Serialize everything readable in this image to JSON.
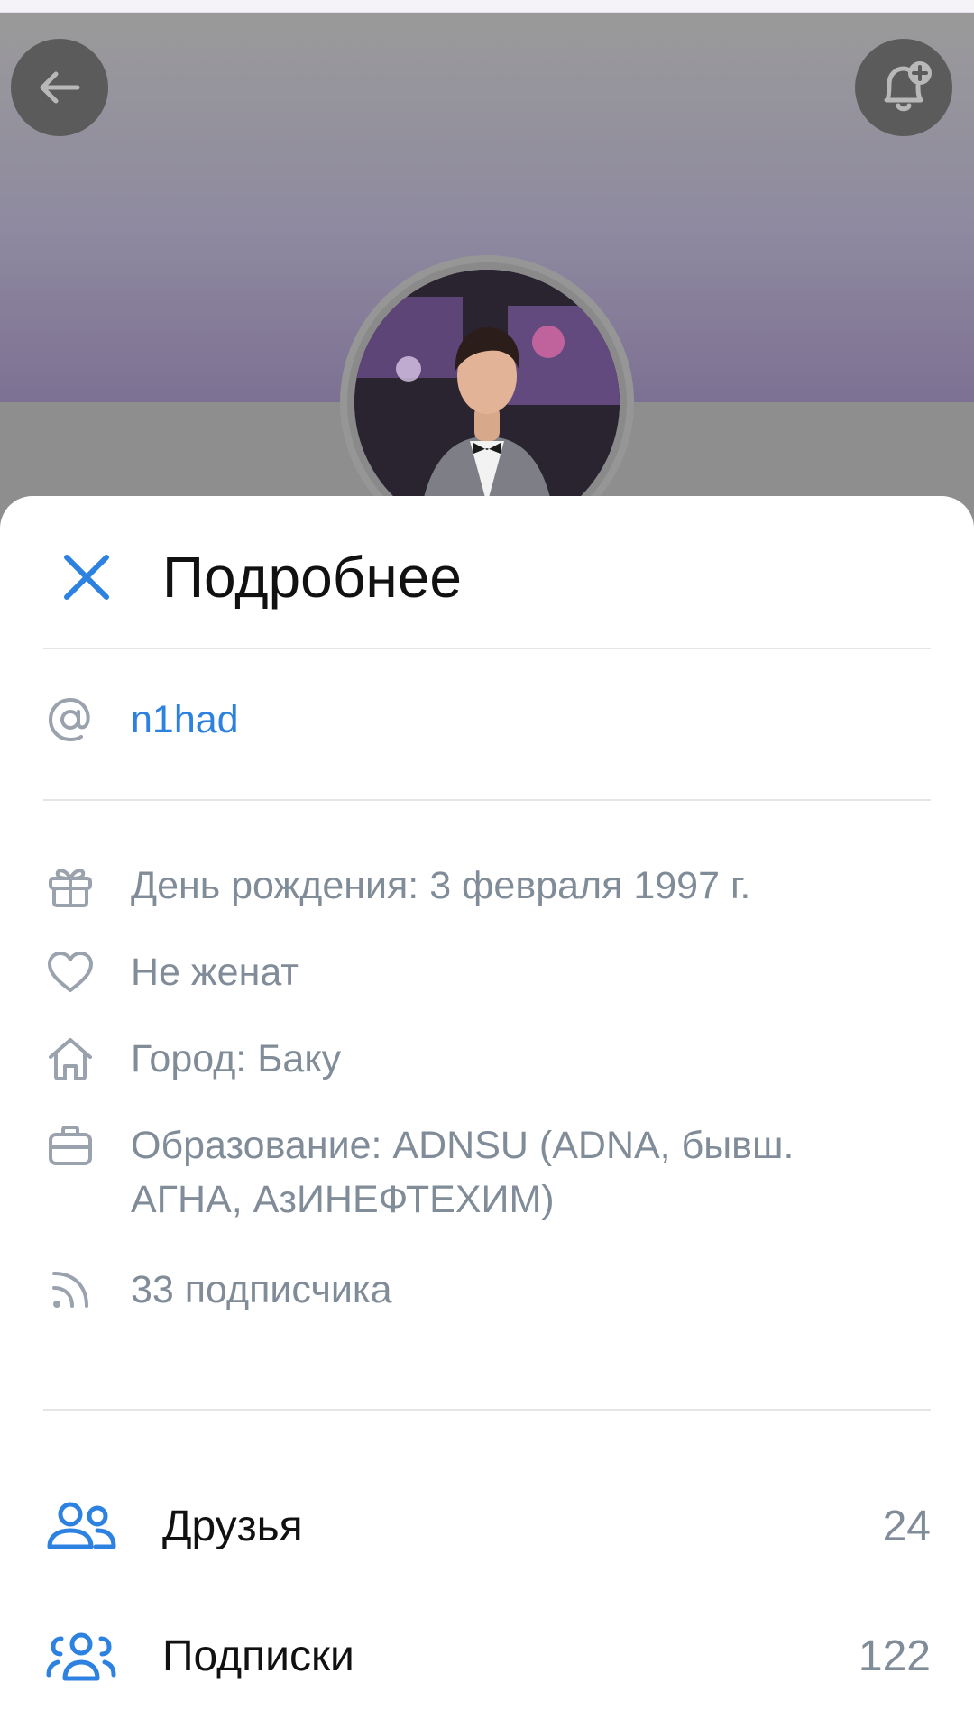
{
  "header": {
    "back_icon": "arrow-left-icon",
    "notify_icon": "bell-plus-icon"
  },
  "sheet": {
    "close_icon": "close-icon",
    "title": "Подробнее"
  },
  "username": {
    "icon": "at-icon",
    "value": "n1had"
  },
  "details": [
    {
      "icon": "gift-icon",
      "text": "День рождения: 3 февраля 1997 г."
    },
    {
      "icon": "heart-icon",
      "text": "Не женат"
    },
    {
      "icon": "home-icon",
      "text": "Город: Баку"
    },
    {
      "icon": "briefcase-icon",
      "line1": "Образование: ADNSU (ADNA, бывш.",
      "line2": "АГНА, АзИНЕФТЕХИМ)"
    },
    {
      "icon": "rss-icon",
      "text": "33 подписчика"
    }
  ],
  "nav": [
    {
      "icon": "friends-icon",
      "label": "Друзья",
      "count": "24"
    },
    {
      "icon": "subscriptions-icon",
      "label": "Подписки",
      "count": "122"
    }
  ],
  "colors": {
    "accent": "#2d81e0",
    "secondary_text": "#818c99",
    "primary_text": "#111111"
  }
}
